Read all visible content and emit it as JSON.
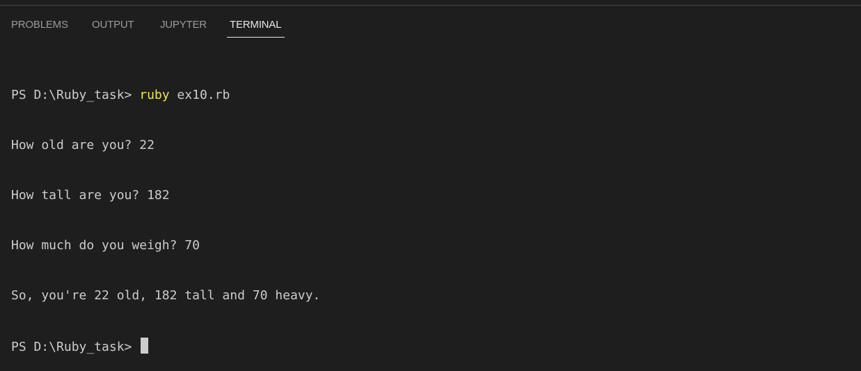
{
  "tabs": [
    {
      "label": "PROBLEMS",
      "active": false
    },
    {
      "label": "OUTPUT",
      "active": false
    },
    {
      "label": "JUPYTER",
      "active": false
    },
    {
      "label": "TERMINAL",
      "active": true
    }
  ],
  "terminal": {
    "lines": [
      {
        "prompt": "PS D:\\Ruby_task> ",
        "command": "ruby",
        "args": " ex10.rb"
      },
      {
        "text": "How old are you? 22"
      },
      {
        "text": "How tall are you? 182"
      },
      {
        "text": "How much do you weigh? 70"
      },
      {
        "text": "So, you're 22 old, 182 tall and 70 heavy."
      },
      {
        "prompt": "PS D:\\Ruby_task> "
      }
    ]
  },
  "colors": {
    "background": "#1e1e1e",
    "text": "#cccccc",
    "command": "#f0e45a",
    "active_tab": "#e7e7e7",
    "inactive_tab": "#9a9a9a"
  }
}
